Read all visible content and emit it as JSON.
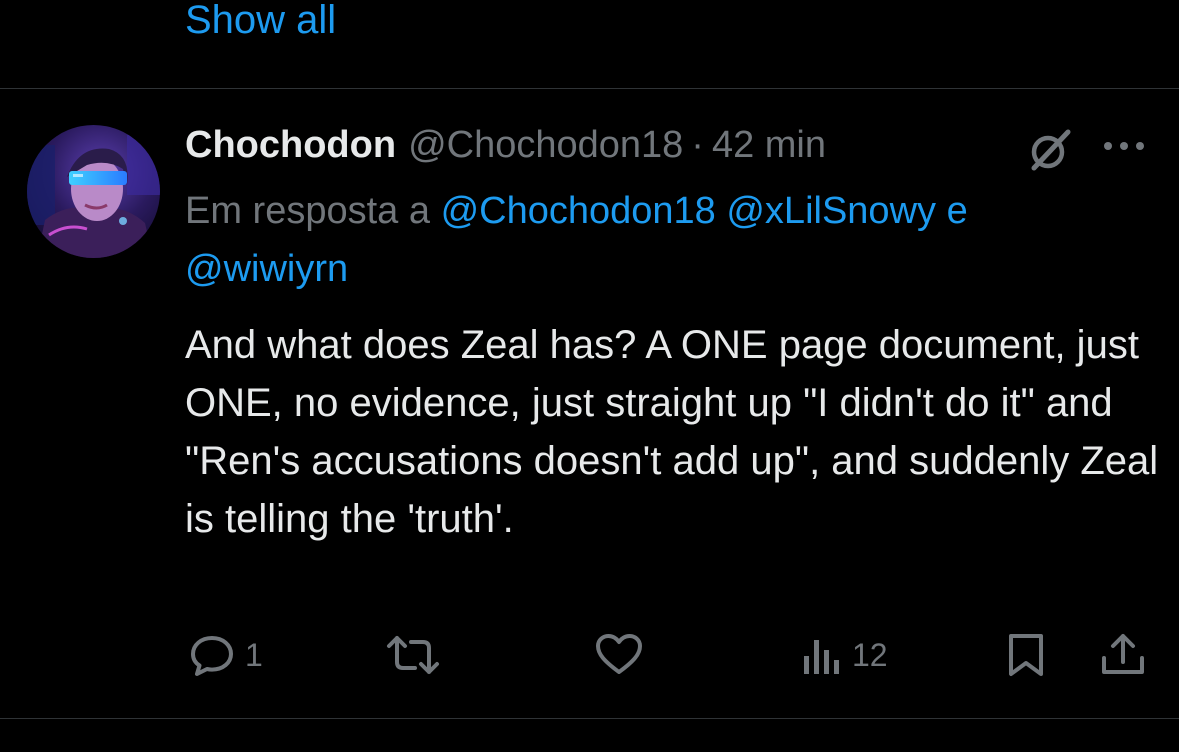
{
  "thread": {
    "show_all_label": "Show all"
  },
  "tweet": {
    "author": {
      "display_name": "Chochodon",
      "handle": "@Chochodon18",
      "avatar_icon": "avatar-image"
    },
    "separator": "·",
    "time": "42 min",
    "reply_to": {
      "prefix": "Em resposta a",
      "mention1": "@Chochodon18",
      "mention2": "@xLilSnowy",
      "conjunction": "e",
      "mention3": "@wiwiyrn"
    },
    "text": "And what does Zeal has? A ONE page document, just ONE, no evidence, just straight up \"I didn't do it\" and \"Ren's accusations doesn't add up\", and suddenly Zeal is telling the 'truth'.",
    "actions": {
      "reply_count": "1",
      "repost_count": "",
      "like_count": "",
      "views_count": "12"
    }
  },
  "colors": {
    "background": "#000000",
    "text_primary": "#e7e9ea",
    "text_secondary": "#71767b",
    "accent": "#1d9bf0",
    "divider": "#2f3336"
  },
  "icons": {
    "header": [
      "grok-icon",
      "more-icon"
    ],
    "actions": [
      "reply-icon",
      "repost-icon",
      "like-icon",
      "views-icon",
      "bookmark-icon",
      "share-icon"
    ]
  }
}
